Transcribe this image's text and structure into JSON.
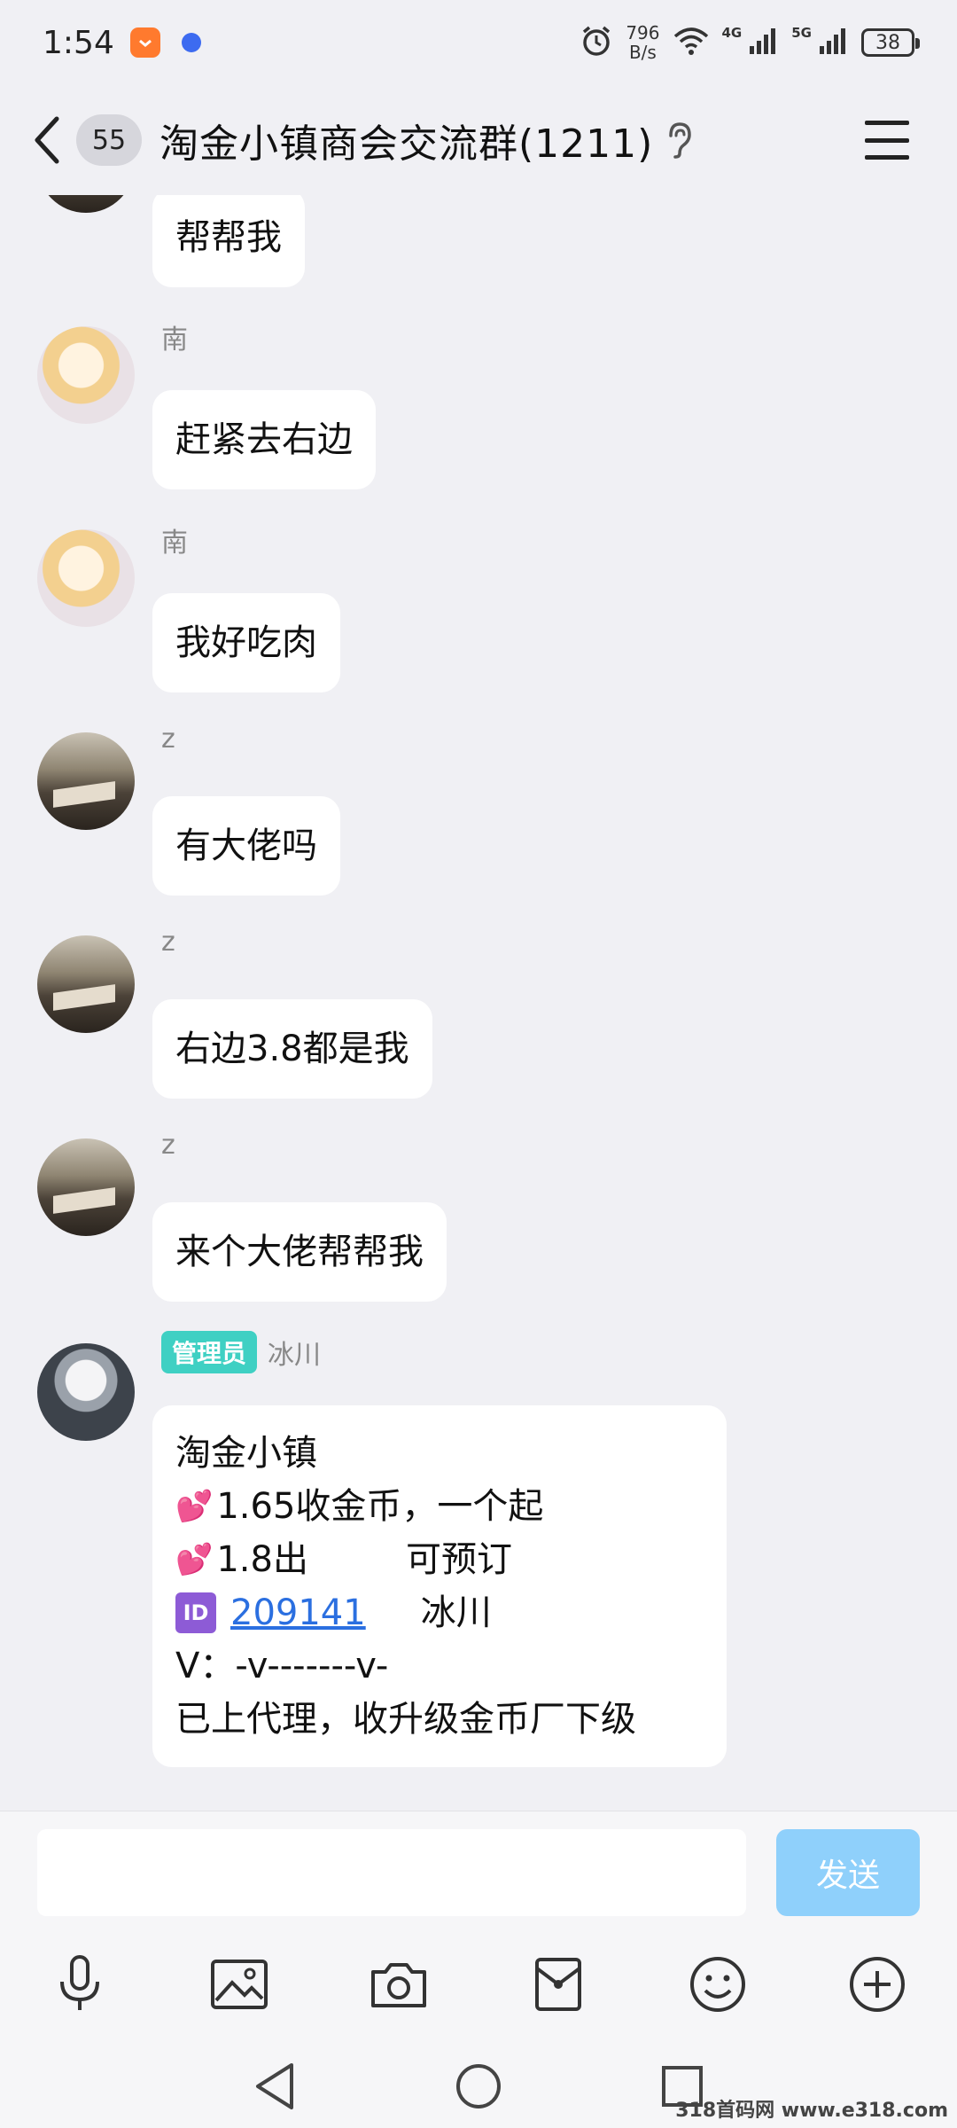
{
  "status_bar": {
    "time": "1:54",
    "net_speed_value": "796",
    "net_speed_unit": "B/s",
    "net_label_1": "4G",
    "net_label_2": "5G",
    "battery": "38"
  },
  "header": {
    "unread_count": "55",
    "title": "淘金小镇商会交流群(1211)"
  },
  "messages": [
    {
      "sender": "",
      "text": "帮帮我"
    },
    {
      "sender": "南",
      "text": "赶紧去右边"
    },
    {
      "sender": "南",
      "text": "我好吃肉"
    },
    {
      "sender": "z",
      "text": "有大佬吗"
    },
    {
      "sender": "z",
      "text": "右边3.8都是我"
    },
    {
      "sender": "z",
      "text": "来个大佬帮帮我"
    },
    {
      "tag": "管理员",
      "sender": "冰川",
      "lines": {
        "l1": "淘金小镇",
        "l2": "1.65收金币，一个起",
        "l3a": "1.8出",
        "l3b": "可预订",
        "l4_badge": "ID",
        "l4_id": "209141",
        "l4_name": "冰川",
        "l5": "V：-v-------v-",
        "l6": "已上代理，收升级金币厂下级"
      }
    }
  ],
  "input": {
    "value": "",
    "send_label": "发送"
  },
  "toolbar_icons": [
    "microphone-icon",
    "image-icon",
    "camera-icon",
    "red-packet-icon",
    "emoji-icon",
    "plus-icon"
  ],
  "nav_icons": [
    "back-triangle-icon",
    "home-circle-icon",
    "recents-square-icon"
  ],
  "watermark": "318首码网 www.e318.com",
  "colors": {
    "background": "#f0f0f4",
    "bubble": "#ffffff",
    "admin_tag": "#3fd0c3",
    "send_button": "#8fd0fb",
    "link": "#2b6fe0"
  }
}
